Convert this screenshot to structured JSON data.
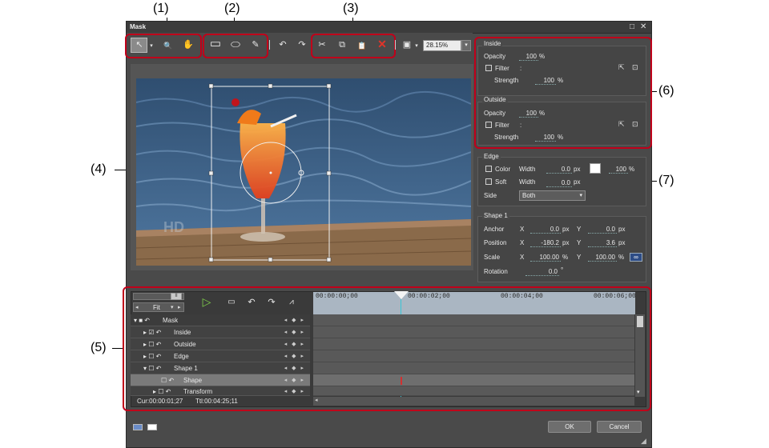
{
  "callouts": {
    "c1": "(1)",
    "c2": "(2)",
    "c3": "(3)",
    "c4": "(4)",
    "c5": "(5)",
    "c6": "(6)",
    "c7": "(7)"
  },
  "window": {
    "title": "Mask",
    "restore_glyph": "□",
    "close_glyph": "✕"
  },
  "toolbar": {
    "select_glyph": "↖",
    "zoom_glyph": "🔍",
    "hand_glyph": "✋",
    "rect_glyph": "▭",
    "ellipse_glyph": "⬭",
    "pen_glyph": "✎",
    "undo_glyph": "↶",
    "redo_glyph": "↷",
    "cut_glyph": "✂",
    "copy_glyph": "⧉",
    "paste_glyph": "📋",
    "delete_glyph": "✕",
    "view_glyph": "▣",
    "zoom_value": "28.15%"
  },
  "preview": {
    "watermark": "HD"
  },
  "inside": {
    "title": "Inside",
    "opacity_label": "Opacity",
    "opacity_value": "100",
    "opacity_unit": "%",
    "filter_label": "Filter",
    "filter_colon": ":",
    "strength_label": "Strength",
    "strength_value": "100",
    "strength_unit": "%"
  },
  "outside": {
    "title": "Outside",
    "opacity_label": "Opacity",
    "opacity_value": "100",
    "opacity_unit": "%",
    "filter_label": "Filter",
    "filter_colon": ":",
    "strength_label": "Strength",
    "strength_value": "100",
    "strength_unit": "%"
  },
  "edge": {
    "title": "Edge",
    "color_label": "Color",
    "width_label": "Width",
    "color_width": "0.0",
    "px": "px",
    "color_pct": "100",
    "pct": "%",
    "soft_label": "Soft",
    "soft_width": "0.0",
    "side_label": "Side",
    "side_value": "Both"
  },
  "shape": {
    "title": "Shape 1",
    "anchor_label": "Anchor",
    "position_label": "Position",
    "scale_label": "Scale",
    "rotation_label": "Rotation",
    "x": "X",
    "y": "Y",
    "anchor_x": "0.0",
    "anchor_y": "0.0",
    "position_x": "-180.2",
    "position_y": "3.6",
    "scale_x": "100.00",
    "scale_y": "100.00",
    "rotation": "0.0",
    "px": "px",
    "pct": "%",
    "deg": "°"
  },
  "timeline": {
    "fit_label": "Fit",
    "pause_glyph": "II",
    "play_glyph": "▷",
    "ruler": [
      "00:00:00;00",
      "00:00:02;00",
      "00:00:04;00",
      "00:00:06;00"
    ],
    "rows": [
      {
        "label": "Mask"
      },
      {
        "label": "Inside"
      },
      {
        "label": "Outside"
      },
      {
        "label": "Edge"
      },
      {
        "label": "Shape 1"
      },
      {
        "label": "Shape"
      },
      {
        "label": "Transform"
      }
    ],
    "keyframe_nav": "◂ ◆ ▸",
    "cur": "Cur:00:00:01;27",
    "ttl": "Ttl:00:04:25;11"
  },
  "footer": {
    "ok": "OK",
    "cancel": "Cancel"
  }
}
